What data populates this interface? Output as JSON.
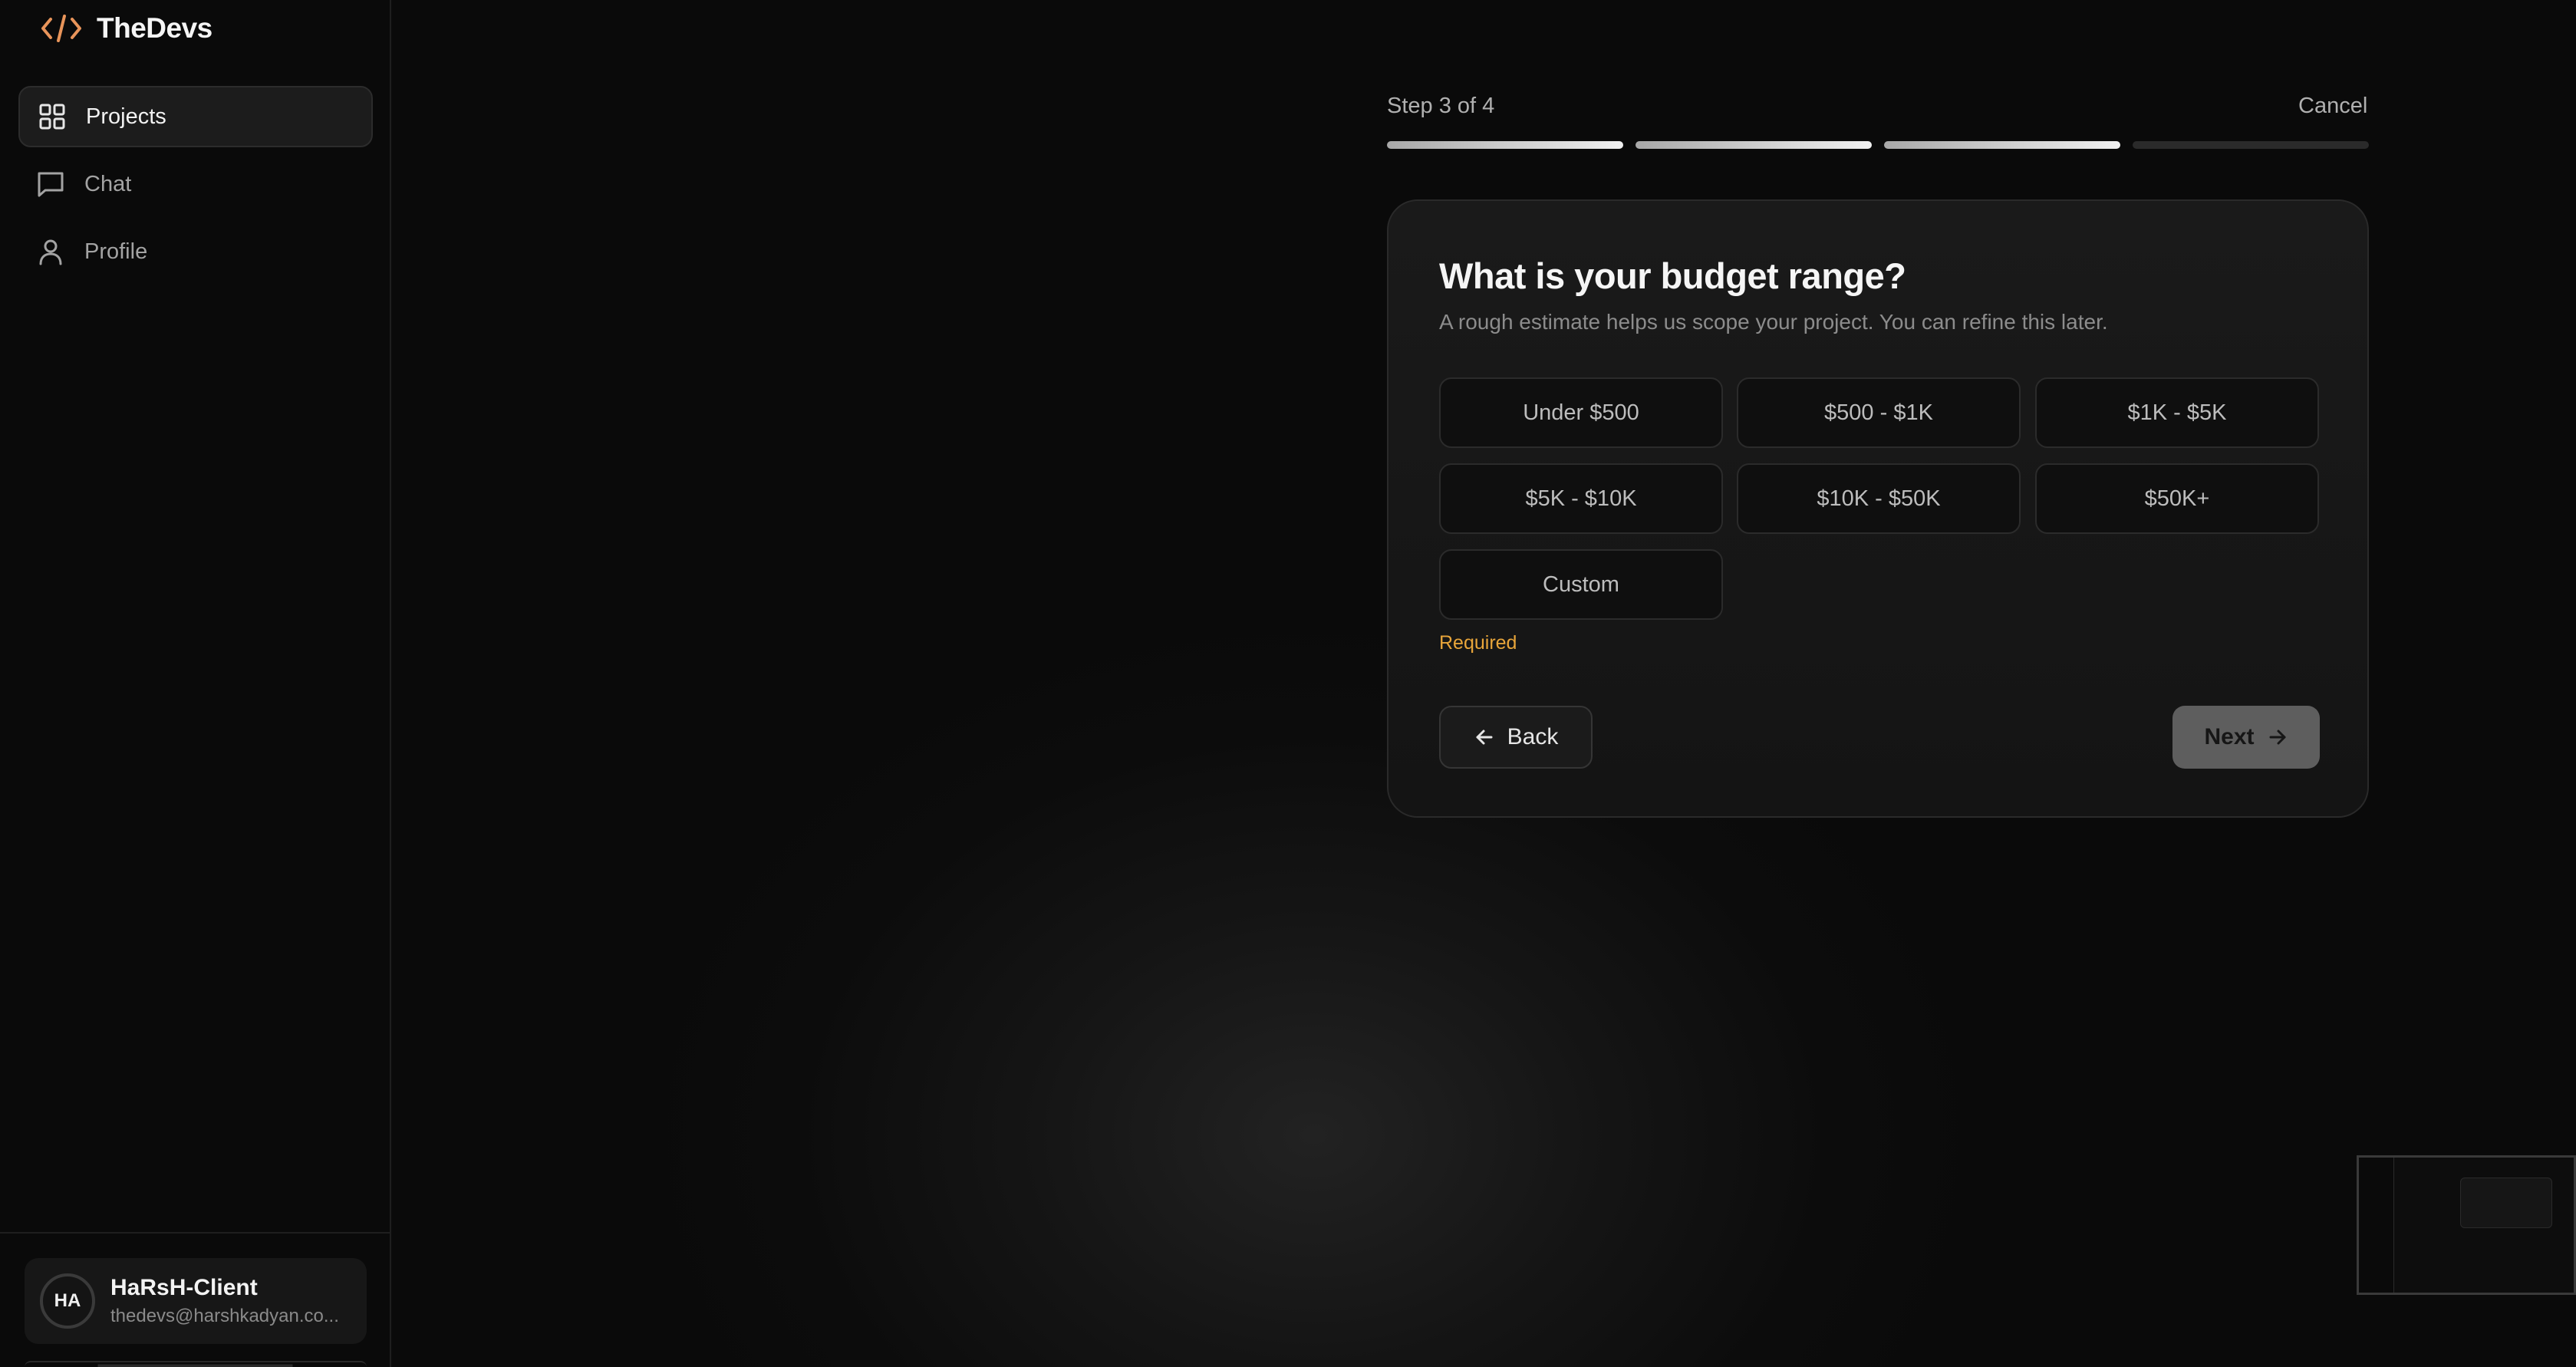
{
  "brand": {
    "name": "TheDevs",
    "icon": "code-icon",
    "accent": "#e8945a"
  },
  "sidebar": {
    "items": [
      {
        "label": "Projects",
        "icon": "grid-icon",
        "active": true
      },
      {
        "label": "Chat",
        "icon": "message-icon",
        "active": false
      },
      {
        "label": "Profile",
        "icon": "user-icon",
        "active": false
      }
    ],
    "user": {
      "initials": "HA",
      "name": "HaRsH-Client",
      "email": "thedevs@harshkadyan.co..."
    }
  },
  "wizard": {
    "step_label": "Step 3 of 4",
    "cancel_label": "Cancel",
    "progress": {
      "total_steps": 4,
      "completed_steps": 3
    },
    "title": "What is your budget range?",
    "subtitle": "A rough estimate helps us scope your project. You can refine this later.",
    "options": [
      "Under $500",
      "$500 - $1K",
      "$1K - $5K",
      "$5K - $10K",
      "$10K - $50K",
      "$50K+",
      "Custom"
    ],
    "required_text": "Required",
    "back_label": "Back",
    "next_label": "Next",
    "colors": {
      "warning": "#e8a53a",
      "next_button": "#5e5e5e"
    }
  }
}
